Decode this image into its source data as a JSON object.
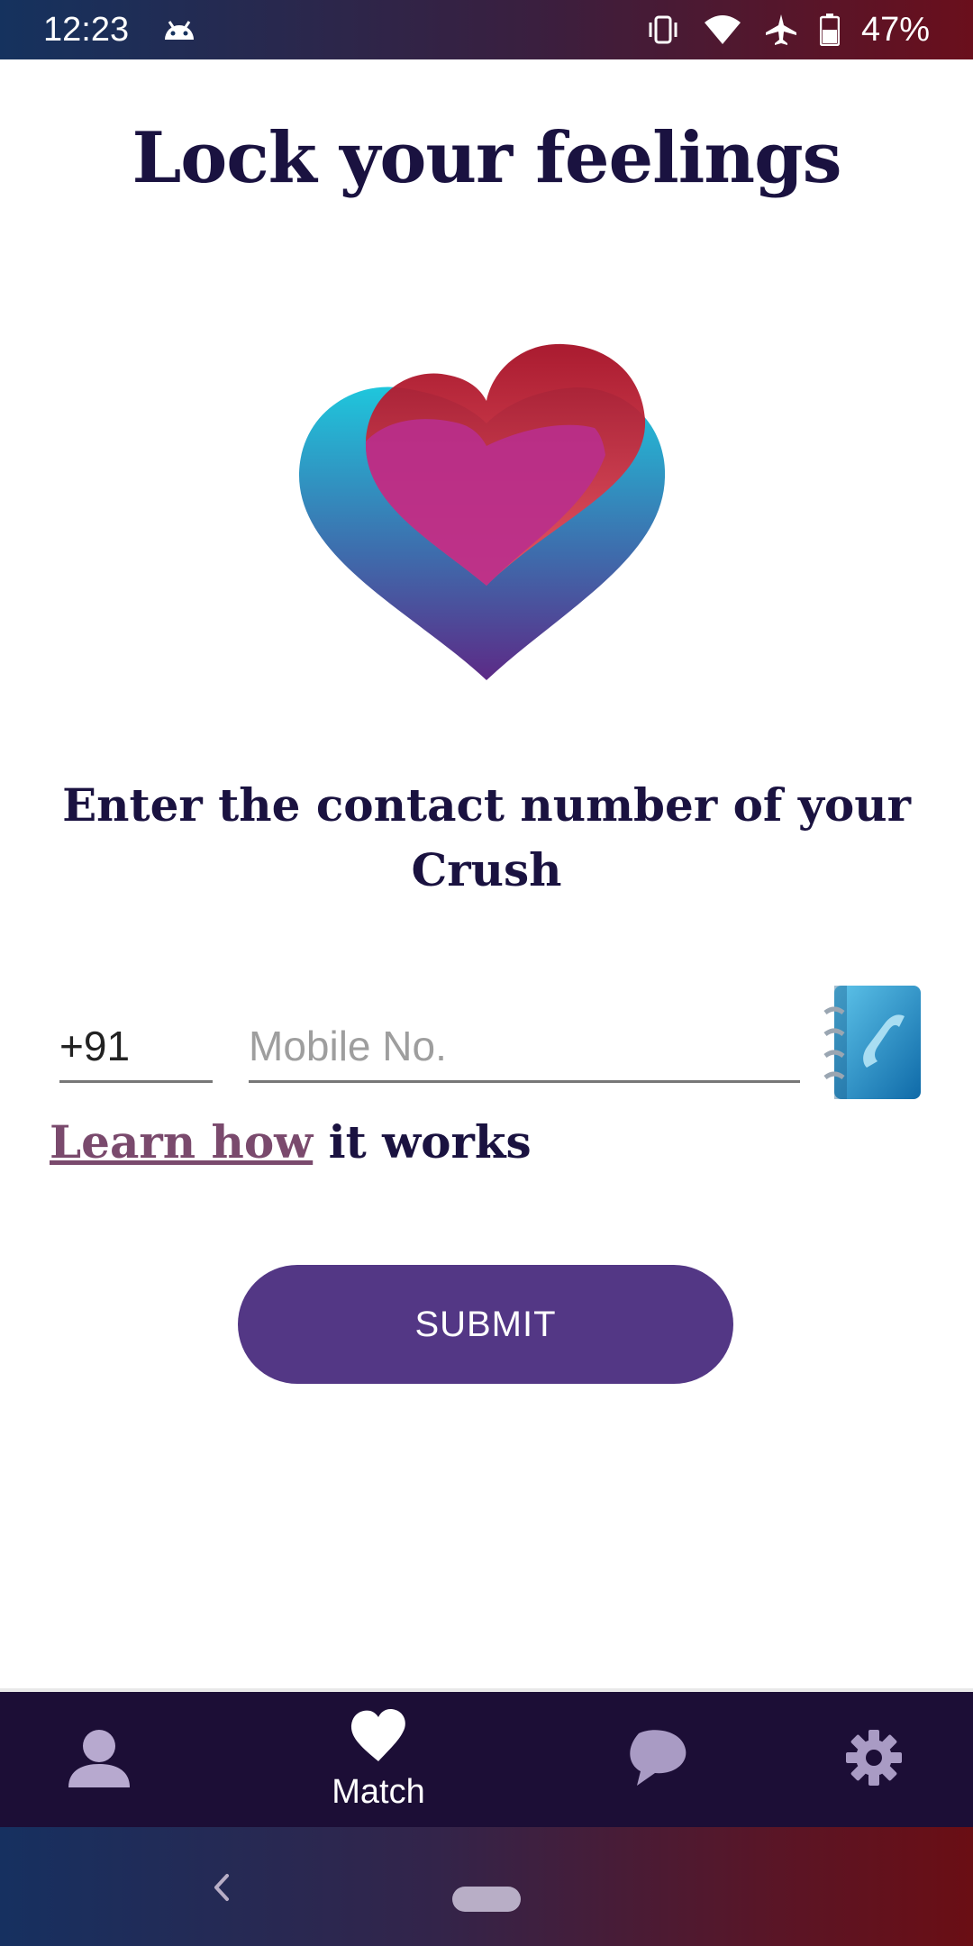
{
  "status_bar": {
    "time": "12:23",
    "battery_percent": "47%",
    "icons": [
      "android-icon",
      "vibrate-icon",
      "wifi-icon",
      "airplane-icon",
      "battery-icon"
    ]
  },
  "page": {
    "title": "Lock your feelings",
    "prompt": "Enter the contact number of your Crush"
  },
  "form": {
    "country_code": "+91",
    "phone_placeholder": "Mobile No.",
    "phone_value": "",
    "contacts_icon": "contact-book-icon"
  },
  "learn": {
    "link_text": "Learn how",
    "rest_text": "it works"
  },
  "submit_label": "SUBMIT",
  "bottom_nav": {
    "items": [
      {
        "icon": "profile-icon",
        "label": ""
      },
      {
        "icon": "heart-icon",
        "label": "Match"
      },
      {
        "icon": "chat-icon",
        "label": ""
      },
      {
        "icon": "settings-icon",
        "label": ""
      }
    ],
    "active_index": 1
  },
  "colors": {
    "primary": "#533785",
    "title_text": "#1a1240",
    "link": "#7a4a6d",
    "nav_background": "#1c0e36"
  }
}
